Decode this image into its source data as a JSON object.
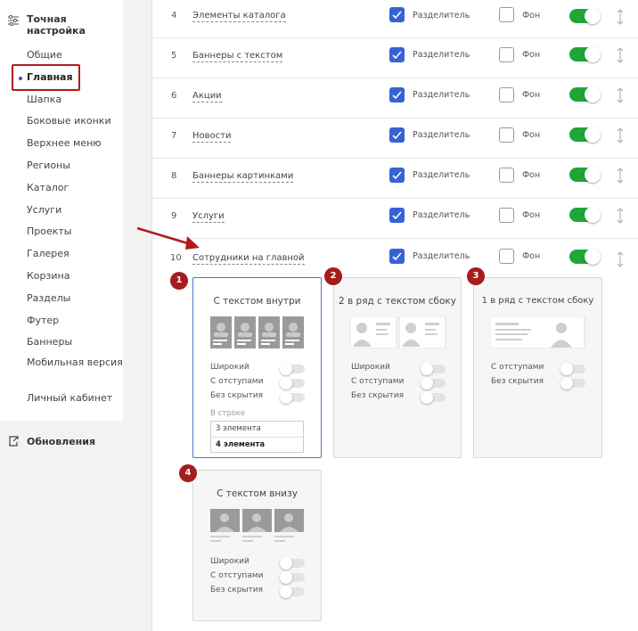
{
  "sidebar": {
    "title": "Точная настройка",
    "items": [
      {
        "label": "Общие"
      },
      {
        "label": "Главная"
      },
      {
        "label": "Шапка"
      },
      {
        "label": "Боковые иконки"
      },
      {
        "label": "Верхнее меню"
      },
      {
        "label": "Регионы"
      },
      {
        "label": "Каталог"
      },
      {
        "label": "Услуги"
      },
      {
        "label": "Проекты"
      },
      {
        "label": "Галерея"
      },
      {
        "label": "Корзина"
      },
      {
        "label": "Разделы"
      },
      {
        "label": "Футер"
      },
      {
        "label": "Баннеры"
      },
      {
        "label": "Мобильная версия"
      },
      {
        "label": "Личный кабинет"
      }
    ],
    "updates_label": "Обновления"
  },
  "rows": [
    {
      "num": "4",
      "name": "Элементы каталога",
      "divider": "Разделитель",
      "bg": "Фон"
    },
    {
      "num": "5",
      "name": "Баннеры с текстом",
      "divider": "Разделитель",
      "bg": "Фон"
    },
    {
      "num": "6",
      "name": "Акции",
      "divider": "Разделитель",
      "bg": "Фон"
    },
    {
      "num": "7",
      "name": "Новости",
      "divider": "Разделитель",
      "bg": "Фон"
    },
    {
      "num": "8",
      "name": "Баннеры картинками",
      "divider": "Разделитель",
      "bg": "Фон"
    },
    {
      "num": "9",
      "name": "Услуги",
      "divider": "Разделитель",
      "bg": "Фон"
    },
    {
      "num": "10",
      "name": "Сотрудники на главной",
      "divider": "Разделитель",
      "bg": "Фон"
    }
  ],
  "templates": [
    {
      "badge": "1",
      "title": "С текстом внутри",
      "options": [
        "Широкий",
        "С отступами",
        "Без скрытия"
      ],
      "in_row_label": "В строке",
      "in_row_options": [
        "3 элемента",
        "4 элемента"
      ]
    },
    {
      "badge": "2",
      "title": "2 в ряд с текстом сбоку",
      "options": [
        "Широкий",
        "С отступами",
        "Без скрытия"
      ]
    },
    {
      "badge": "3",
      "title": "1 в ряд с текстом сбоку",
      "options": [
        "С отступами",
        "Без скрытия"
      ]
    },
    {
      "badge": "4",
      "title": "С текстом внизу",
      "options": [
        "Широкий",
        "С отступами",
        "Без скрытия"
      ]
    }
  ],
  "colors": {
    "accent_blue": "#3762d6",
    "toggle_green": "#1fa63a",
    "highlight_red": "#b01c1c",
    "badge_red": "#a51d1d"
  }
}
